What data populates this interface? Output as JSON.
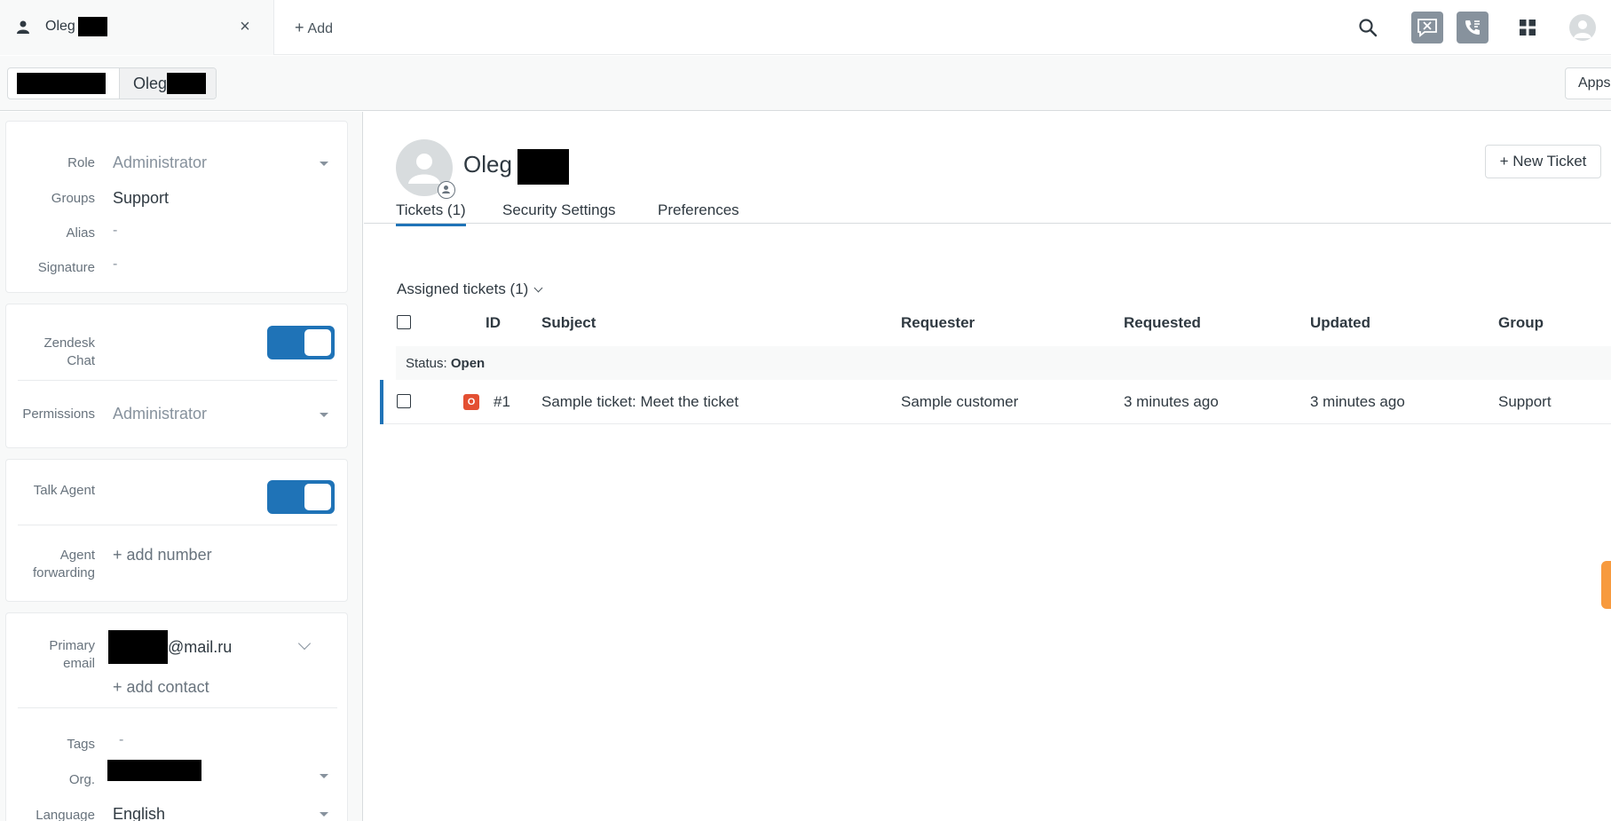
{
  "top_tabs": {
    "active_tab_label": "Oleg",
    "close_glyph": "×",
    "add_label": "Add",
    "add_glyph": "+"
  },
  "top_icons": [
    "search-icon",
    "chat-icon",
    "talk-icon",
    "product-tray-icon",
    "user-avatar-icon"
  ],
  "breadcrumb": {
    "second_label": "Oleg"
  },
  "apps_button": "Apps",
  "left_panel": {
    "role_label": "Role",
    "role_value": "Administrator",
    "groups_label": "Groups",
    "groups_value": "Support",
    "alias_label": "Alias",
    "alias_value": "-",
    "signature_label": "Signature",
    "signature_value": "-",
    "chat_label_1": "Zendesk",
    "chat_label_2": "Chat",
    "chat_enabled": true,
    "permissions_label": "Permissions",
    "permissions_value": "Administrator",
    "talk_label": "Talk Agent",
    "talk_enabled": true,
    "forwarding_label_1": "Agent",
    "forwarding_label_2": "forwarding",
    "add_number": "+ add number",
    "primary_label_1": "Primary",
    "primary_label_2": "email",
    "email_domain": "@mail.ru",
    "add_contact": "+ add contact",
    "tags_label": "Tags",
    "tags_value": "-",
    "org_label": "Org.",
    "language_label": "Language",
    "language_value": "English"
  },
  "profile": {
    "name": "Oleg",
    "new_ticket": "+ New Ticket"
  },
  "tabs": {
    "tickets": "Tickets (1)",
    "security": "Security Settings",
    "preferences": "Preferences"
  },
  "tickets": {
    "assigned_label": "Assigned tickets (1)",
    "columns": [
      "ID",
      "Subject",
      "Requester",
      "Requested",
      "Updated",
      "Group"
    ],
    "status_prefix": "Status:",
    "status_value": "Open",
    "rows": [
      {
        "status_letter": "O",
        "id": "#1",
        "subject": "Sample ticket: Meet the ticket",
        "requester": "Sample customer",
        "requested": "3 minutes ago",
        "updated": "3 minutes ago",
        "group": "Support"
      }
    ]
  },
  "colors": {
    "accent": "#1f73b7",
    "open_status": "#e34f32",
    "side_handle": "#f79a3e"
  }
}
